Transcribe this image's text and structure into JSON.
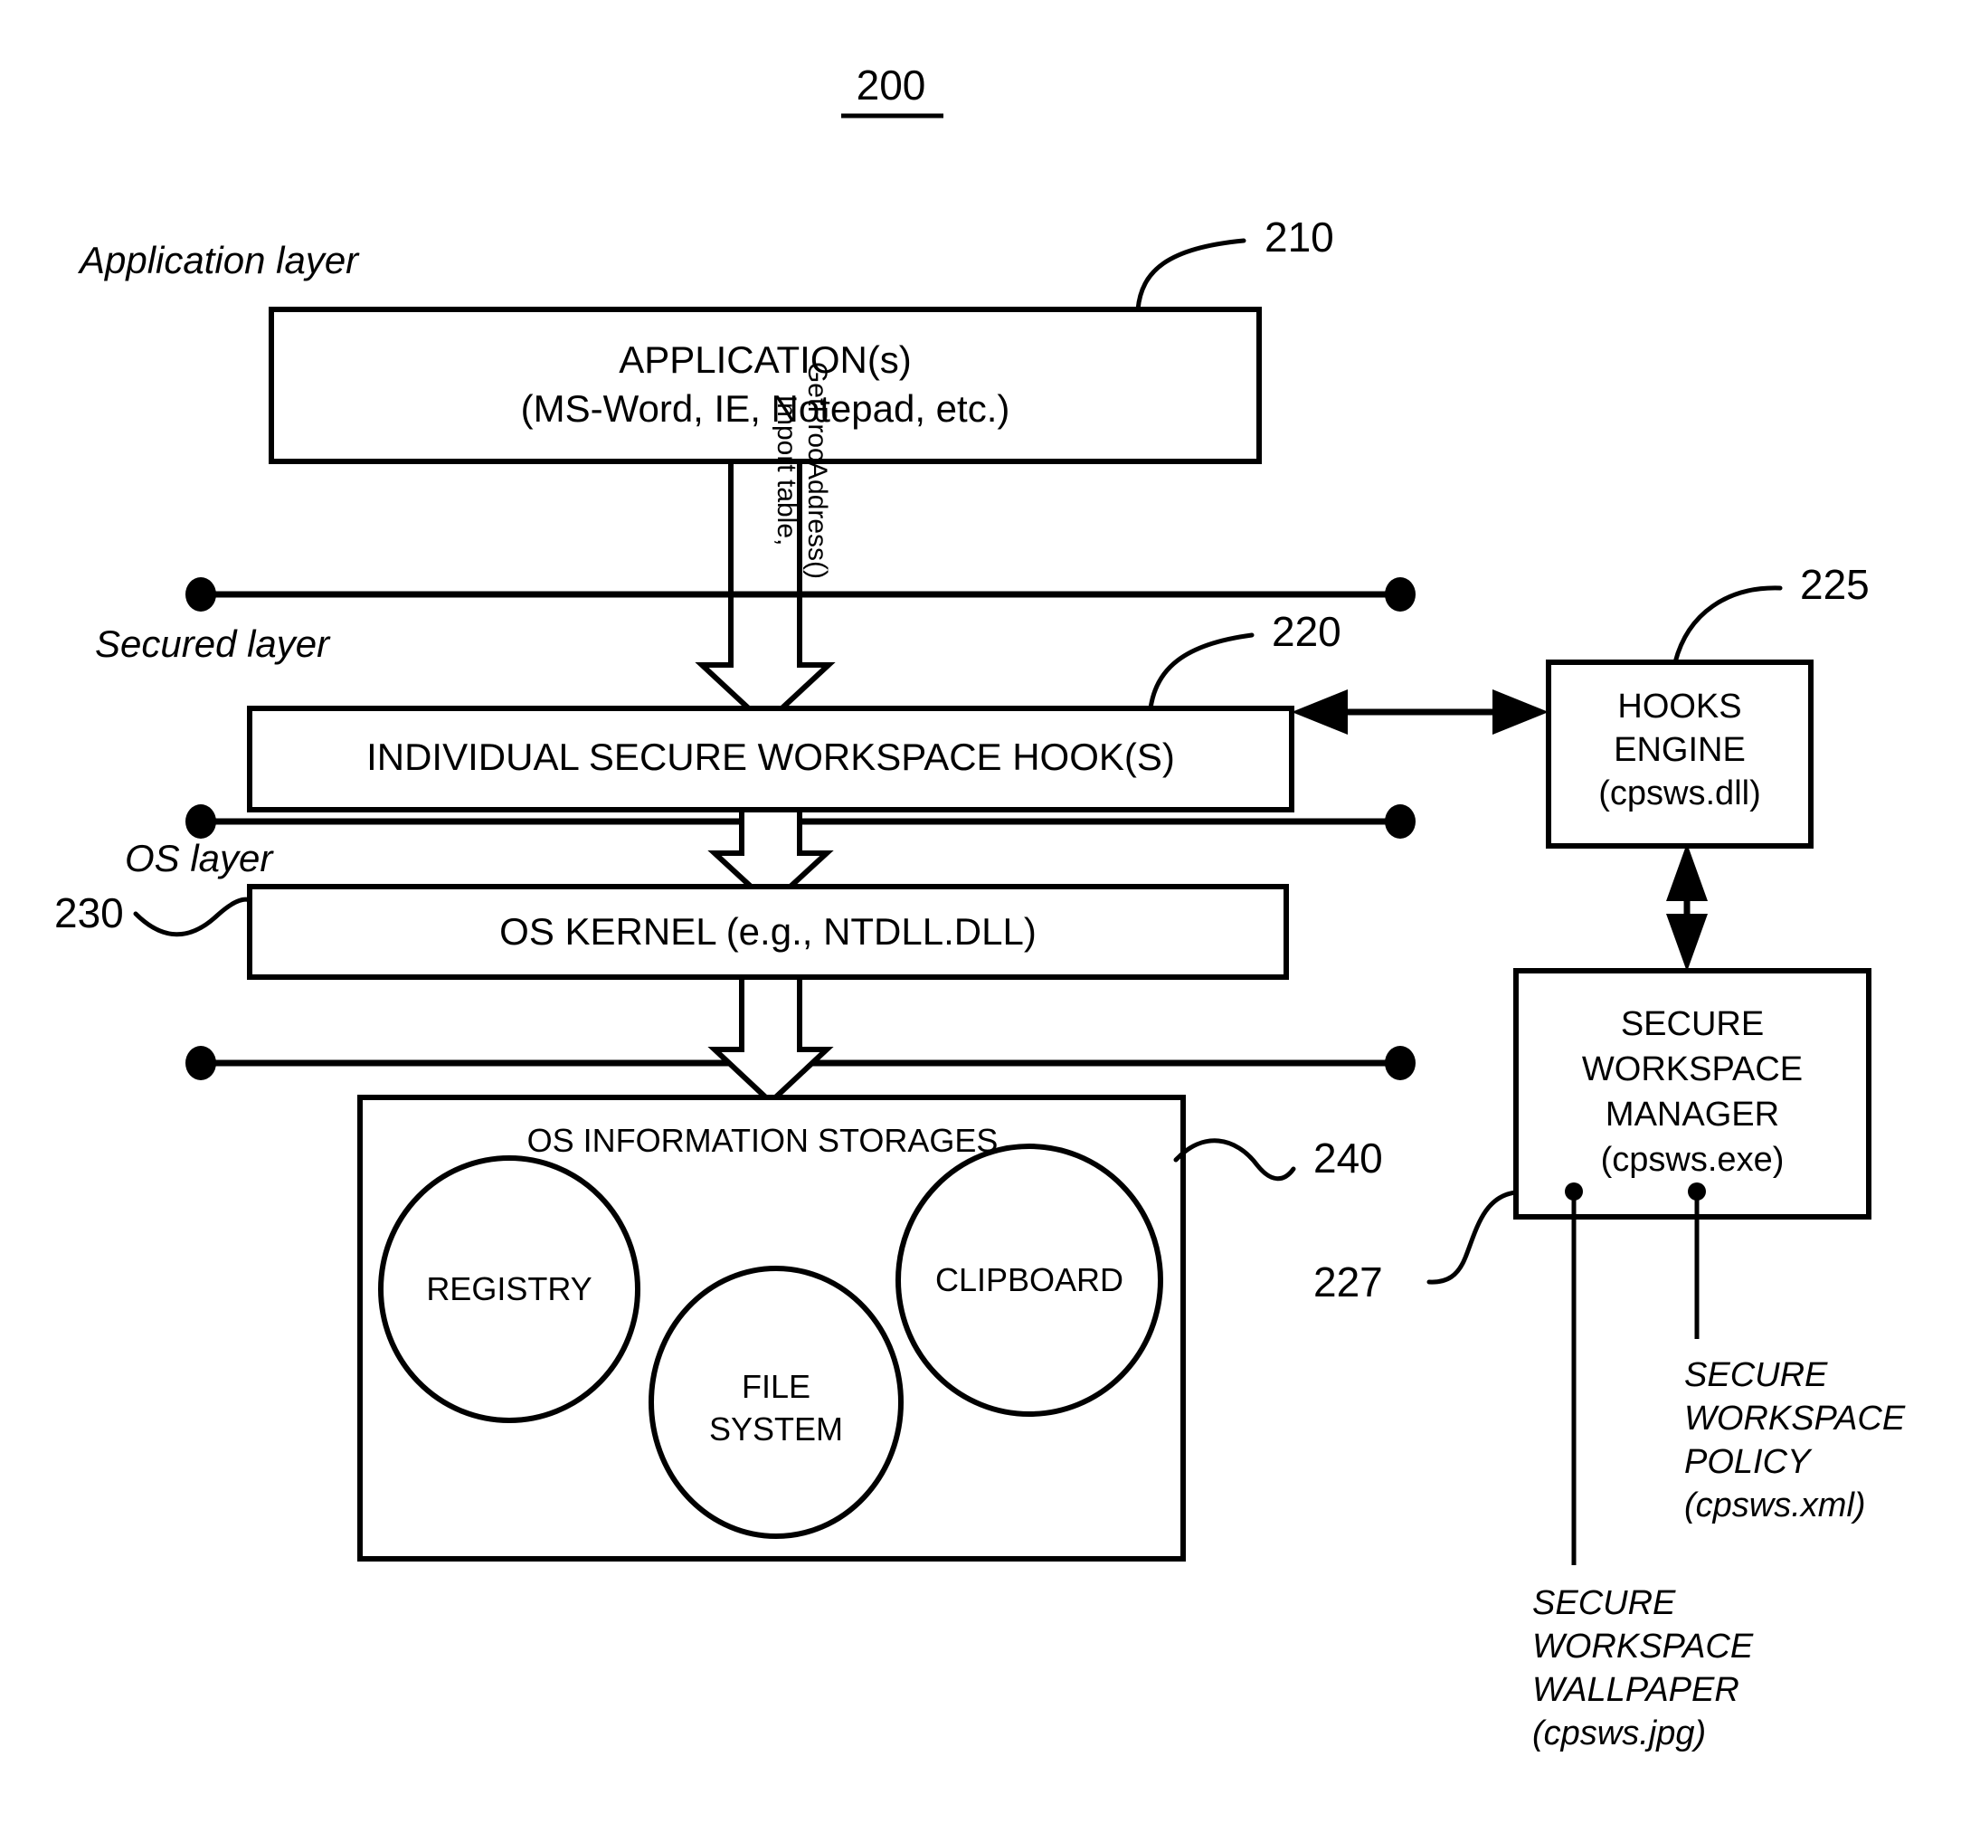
{
  "figure": {
    "number": "200"
  },
  "layers": [
    {
      "id": "application-layer",
      "label": "Application  layer"
    },
    {
      "id": "secured-layer",
      "label": "Secured layer"
    },
    {
      "id": "os-layer",
      "label": "OS layer"
    }
  ],
  "refs": {
    "application": "210",
    "hooks": "220",
    "hooks_engine": "225",
    "workspace_manager": "227",
    "os_kernel": "230",
    "storages": "240"
  },
  "blocks": {
    "application": {
      "line1": "APPLICATION(s)",
      "line2": "(MS-Word, IE, Notepad, etc.)"
    },
    "hooks": {
      "line1": "INDIVIDUAL SECURE WORKSPACE HOOK(S)"
    },
    "os_kernel": {
      "line1": "OS KERNEL (e.g., NTDLL.DLL)"
    },
    "storages": {
      "title": "OS INFORMATION STORAGES",
      "circles": [
        {
          "id": "registry",
          "lines": [
            "REGISTRY"
          ]
        },
        {
          "id": "file-system",
          "lines": [
            "FILE",
            "SYSTEM"
          ]
        },
        {
          "id": "clipboard",
          "lines": [
            "CLIPBOARD"
          ]
        }
      ]
    },
    "hooks_engine": {
      "line1": "HOOKS",
      "line2": "ENGINE",
      "line3": "(cpsws.dll)"
    },
    "workspace_manager": {
      "line1": "SECURE",
      "line2": "WORKSPACE",
      "line3": "MANAGER",
      "line4": "(cpsws.exe)"
    }
  },
  "connector_labels": {
    "import_table": "Import table,",
    "getprocaddress": "GetProcAddress()"
  },
  "notes": {
    "policy": {
      "line1": "SECURE",
      "line2": "WORKSPACE",
      "line3": "POLICY",
      "line4": "(cpsws.xml)"
    },
    "wallpaper": {
      "line1": "SECURE",
      "line2": "WORKSPACE",
      "line3": "WALLPAPER",
      "line4": "(cpsws.jpg)"
    }
  },
  "colors": {
    "ink": "#000000",
    "paper": "#ffffff"
  }
}
